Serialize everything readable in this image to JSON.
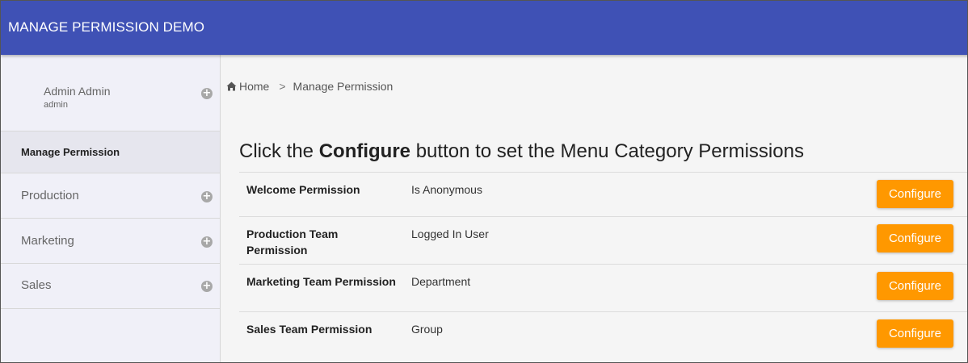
{
  "header": {
    "title": "MANAGE PERMISSION DEMO"
  },
  "user": {
    "name": "Admin Admin",
    "role": "admin",
    "expand_icon": "plus-circle-icon"
  },
  "sidebar": {
    "items": [
      {
        "label": "Manage Permission",
        "active": true
      },
      {
        "label": "Production",
        "icon": "plus-circle-icon"
      },
      {
        "label": "Marketing",
        "icon": "plus-circle-icon"
      },
      {
        "label": "Sales",
        "icon": "plus-circle-icon"
      }
    ]
  },
  "breadcrumb": {
    "home_icon": "home-icon",
    "home": "Home",
    "separator": ">",
    "current": "Manage Permission"
  },
  "main": {
    "heading_prefix": "Click the ",
    "heading_bold": "Configure",
    "heading_suffix": " button to set the Menu Category Permissions"
  },
  "permissions": [
    {
      "name": "Welcome Permission",
      "type": "Is Anonymous",
      "button": "Configure"
    },
    {
      "name": "Production Team Permission",
      "type": "Logged In User",
      "button": "Configure"
    },
    {
      "name": "Marketing Team Permission",
      "type": "Department",
      "button": "Configure"
    },
    {
      "name": "Sales Team Permission",
      "type": "Group",
      "button": "Configure"
    }
  ],
  "colors": {
    "header": "#3f51b5",
    "button": "#ff9800",
    "sidebar": "#f0f0f8"
  }
}
